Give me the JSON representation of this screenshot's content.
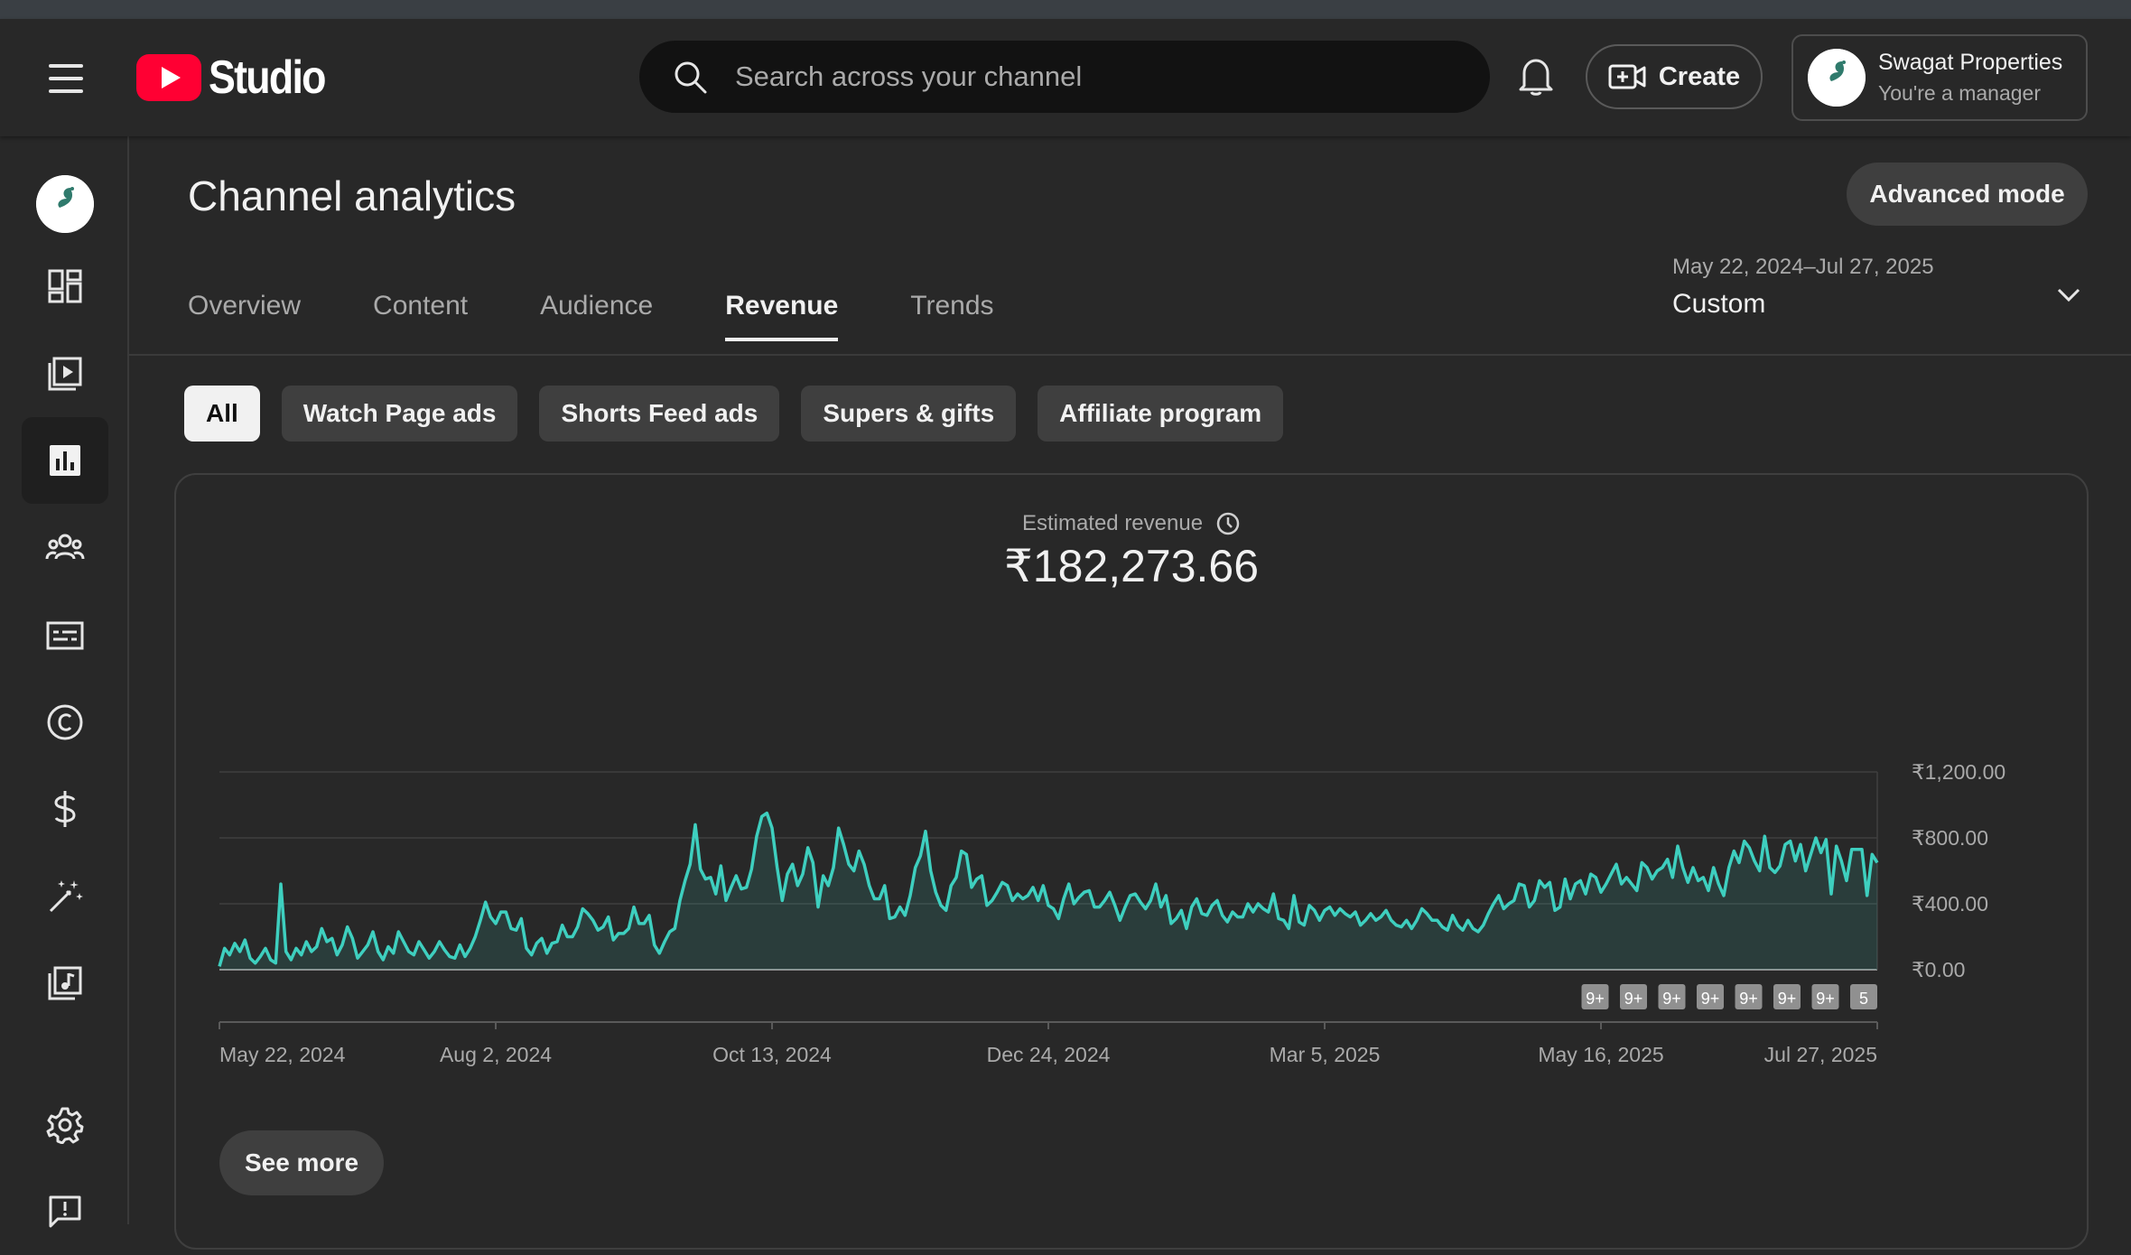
{
  "header": {
    "logo_text": "Studio",
    "search_placeholder": "Search across your channel",
    "create_label": "Create",
    "account": {
      "name": "Swagat Properties",
      "role": "You're a manager"
    }
  },
  "sidebar": {
    "items": [
      {
        "name": "channel-avatar"
      },
      {
        "name": "dashboard-icon"
      },
      {
        "name": "content-icon"
      },
      {
        "name": "analytics-icon",
        "active": true
      },
      {
        "name": "community-icon"
      },
      {
        "name": "subtitles-icon"
      },
      {
        "name": "copyright-icon"
      },
      {
        "name": "earn-icon"
      },
      {
        "name": "customization-icon"
      },
      {
        "name": "audio-library-icon"
      },
      {
        "name": "settings-icon"
      },
      {
        "name": "feedback-icon"
      }
    ]
  },
  "page": {
    "title": "Channel analytics",
    "advanced_mode_label": "Advanced mode",
    "tabs": [
      "Overview",
      "Content",
      "Audience",
      "Revenue",
      "Trends"
    ],
    "active_tab": "Revenue",
    "date_range": {
      "dates": "May 22, 2024–Jul 27, 2025",
      "mode": "Custom"
    },
    "chips": [
      "All",
      "Watch Page ads",
      "Shorts Feed ads",
      "Supers & gifts",
      "Affiliate program"
    ],
    "active_chip": "All"
  },
  "metric": {
    "label": "Estimated revenue",
    "value": "₹182,273.66"
  },
  "see_more_label": "See more",
  "colors": {
    "line": "#3ecfbf",
    "accent": "#ff0033",
    "background": "#282828"
  },
  "chart_data": {
    "type": "line",
    "x_start": "May 22, 2024",
    "x_end": "Jul 27, 2025",
    "x_ticks": [
      "May 22, 2024",
      "Aug 2, 2024",
      "Oct 13, 2024",
      "Dec 24, 2024",
      "Mar 5, 2025",
      "May 16, 2025",
      "Jul 27, 2025"
    ],
    "y_ticks": [
      "₹1,200.00",
      "₹800.00",
      "₹400.00",
      "₹0.00"
    ],
    "ylim": [
      0,
      1200
    ],
    "grid": true,
    "annotation_badges": [
      "9+",
      "9+",
      "9+",
      "9+",
      "9+",
      "9+",
      "9+",
      "5"
    ],
    "series": [
      {
        "values": [
          20,
          130,
          90,
          160,
          110,
          180,
          70,
          40,
          80,
          130,
          60,
          40,
          520,
          110,
          60,
          130,
          90,
          170,
          110,
          140,
          250,
          170,
          190,
          90,
          150,
          260,
          190,
          70,
          110,
          150,
          230,
          110,
          60,
          140,
          100,
          230,
          170,
          110,
          90,
          170,
          120,
          70,
          110,
          170,
          120,
          80,
          70,
          150,
          80,
          130,
          200,
          300,
          410,
          320,
          280,
          350,
          350,
          250,
          240,
          310,
          130,
          90,
          160,
          190,
          100,
          160,
          170,
          270,
          200,
          200,
          260,
          370,
          340,
          300,
          240,
          260,
          320,
          180,
          220,
          220,
          250,
          380,
          280,
          280,
          330,
          150,
          100,
          170,
          230,
          250,
          420,
          540,
          640,
          880,
          610,
          550,
          560,
          460,
          630,
          420,
          500,
          570,
          490,
          500,
          610,
          810,
          930,
          950,
          860,
          620,
          420,
          580,
          640,
          510,
          580,
          740,
          650,
          380,
          570,
          510,
          620,
          860,
          760,
          640,
          600,
          720,
          640,
          510,
          430,
          430,
          510,
          310,
          320,
          380,
          330,
          450,
          620,
          690,
          840,
          600,
          470,
          390,
          360,
          510,
          560,
          720,
          700,
          500,
          550,
          570,
          390,
          420,
          470,
          530,
          510,
          420,
          460,
          430,
          450,
          500,
          420,
          510,
          390,
          370,
          310,
          430,
          520,
          400,
          440,
          470,
          480,
          380,
          380,
          420,
          470,
          390,
          300,
          380,
          450,
          460,
          410,
          370,
          420,
          520,
          380,
          450,
          280,
          310,
          360,
          250,
          380,
          430,
          340,
          330,
          390,
          420,
          330,
          290,
          350,
          320,
          320,
          400,
          350,
          400,
          370,
          350,
          460,
          310,
          300,
          250,
          450,
          290,
          270,
          390,
          360,
          300,
          360,
          380,
          330,
          370,
          340,
          320,
          350,
          270,
          300,
          340,
          300,
          320,
          360,
          300,
          270,
          260,
          300,
          250,
          300,
          370,
          340,
          300,
          300,
          260,
          240,
          330,
          270,
          240,
          300,
          250,
          230,
          270,
          340,
          400,
          450,
          370,
          400,
          420,
          520,
          510,
          380,
          420,
          540,
          500,
          530,
          360,
          380,
          550,
          430,
          520,
          540,
          460,
          580,
          560,
          470,
          520,
          580,
          640,
          520,
          560,
          520,
          480,
          650,
          620,
          550,
          600,
          620,
          670,
          560,
          750,
          620,
          530,
          620,
          540,
          560,
          480,
          620,
          520,
          450,
          620,
          720,
          650,
          780,
          740,
          660,
          600,
          810,
          620,
          590,
          630,
          760,
          780,
          660,
          760,
          600,
          700,
          800,
          710,
          790,
          460,
          750,
          660,
          540,
          730,
          730,
          730,
          450,
          700,
          650
        ]
      }
    ]
  }
}
